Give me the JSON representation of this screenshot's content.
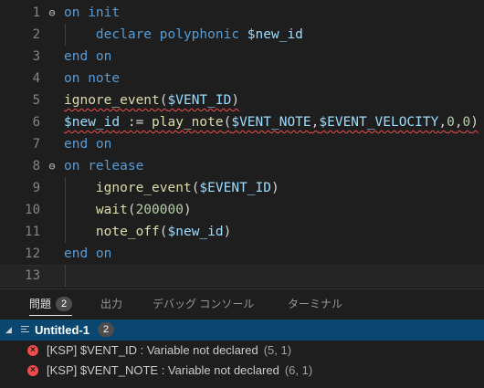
{
  "editor": {
    "lines": [
      {
        "num": "1",
        "fold": "⊖",
        "code": [
          {
            "t": "on init",
            "c": "kw"
          }
        ]
      },
      {
        "num": "2",
        "fold": "",
        "indent": true,
        "code": [
          {
            "t": "    declare polyphonic ",
            "c": "kw"
          },
          {
            "t": "$new_id",
            "c": "var"
          }
        ]
      },
      {
        "num": "3",
        "fold": "",
        "code": [
          {
            "t": "end on",
            "c": "kw"
          }
        ]
      },
      {
        "num": "4",
        "fold": "",
        "code": [
          {
            "t": "on note",
            "c": "kw"
          }
        ]
      },
      {
        "num": "5",
        "fold": "",
        "code": [
          {
            "t": "ignore_event",
            "c": "fn",
            "err": true
          },
          {
            "t": "(",
            "c": "pl",
            "err": true
          },
          {
            "t": "$VENT_ID",
            "c": "var",
            "err": true
          },
          {
            "t": ")",
            "c": "pl",
            "err": true
          }
        ]
      },
      {
        "num": "6",
        "fold": "",
        "code": [
          {
            "t": "$new_id",
            "c": "var",
            "err": true
          },
          {
            "t": " := ",
            "c": "pl",
            "err": true
          },
          {
            "t": "play_note",
            "c": "fn",
            "err": true
          },
          {
            "t": "(",
            "c": "pl",
            "err": true
          },
          {
            "t": "$VENT_NOTE",
            "c": "var",
            "err": true
          },
          {
            "t": ",",
            "c": "pl",
            "err": true
          },
          {
            "t": "$EVENT_VELOCITY",
            "c": "var",
            "err": true
          },
          {
            "t": ",",
            "c": "pl",
            "err": true
          },
          {
            "t": "0",
            "c": "num",
            "err": true
          },
          {
            "t": ",",
            "c": "pl",
            "err": true
          },
          {
            "t": "0",
            "c": "num",
            "err": true
          },
          {
            "t": ")",
            "c": "pl",
            "err": true
          }
        ]
      },
      {
        "num": "7",
        "fold": "",
        "code": [
          {
            "t": "end on",
            "c": "kw"
          }
        ]
      },
      {
        "num": "8",
        "fold": "⊖",
        "code": [
          {
            "t": "on release",
            "c": "kw"
          }
        ]
      },
      {
        "num": "9",
        "fold": "",
        "indent": true,
        "code": [
          {
            "t": "    ignore_event",
            "c": "fn"
          },
          {
            "t": "(",
            "c": "pl"
          },
          {
            "t": "$EVENT_ID",
            "c": "var"
          },
          {
            "t": ")",
            "c": "pl"
          }
        ]
      },
      {
        "num": "10",
        "fold": "",
        "indent": true,
        "code": [
          {
            "t": "    wait",
            "c": "fn"
          },
          {
            "t": "(",
            "c": "pl"
          },
          {
            "t": "200000",
            "c": "num"
          },
          {
            "t": ")",
            "c": "pl"
          }
        ]
      },
      {
        "num": "11",
        "fold": "",
        "indent": true,
        "code": [
          {
            "t": "    note_off",
            "c": "fn"
          },
          {
            "t": "(",
            "c": "pl"
          },
          {
            "t": "$new_id",
            "c": "var"
          },
          {
            "t": ")",
            "c": "pl"
          }
        ]
      },
      {
        "num": "12",
        "fold": "",
        "code": [
          {
            "t": "end on",
            "c": "kw"
          }
        ]
      },
      {
        "num": "13",
        "fold": "",
        "current": true,
        "code": []
      }
    ]
  },
  "panel": {
    "tabs": [
      {
        "label": "問題",
        "badge": "2",
        "active": true
      },
      {
        "label": "出力",
        "badge": null,
        "active": false
      },
      {
        "label": "デバッグ コンソール",
        "badge": null,
        "active": false
      },
      {
        "label": "ターミナル",
        "badge": null,
        "active": false
      }
    ],
    "file": {
      "twist": "◢",
      "name": "Untitled-1",
      "count": "2"
    },
    "problems": [
      {
        "icon": "×",
        "message": "[KSP] $VENT_ID : Variable not declared",
        "pos": "(5, 1)"
      },
      {
        "icon": "×",
        "message": "[KSP] $VENT_NOTE : Variable not declared",
        "pos": "(6, 1)"
      }
    ]
  },
  "colors": {
    "accent": "#094771",
    "error": "#f14c4c",
    "keyword": "#569cd6",
    "function": "#dcdcaa",
    "variable": "#9cdcfe",
    "number": "#b5cea8"
  }
}
